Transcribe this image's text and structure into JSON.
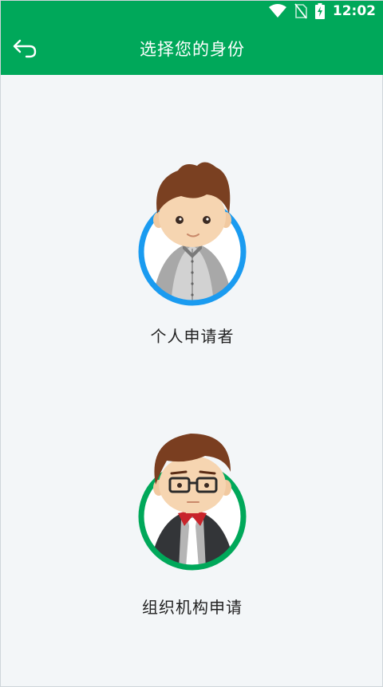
{
  "status_bar": {
    "time": "12:02",
    "icons": [
      "wifi-icon",
      "no-sim-icon",
      "battery-charging-icon"
    ]
  },
  "app_bar": {
    "title": "选择您的身份",
    "back_icon": "back-arrow-icon"
  },
  "roles": [
    {
      "label": "个人申请者",
      "ring_color": "#1a9bf0"
    },
    {
      "label": "组织机构申请",
      "ring_color": "#00a85a"
    }
  ],
  "colors": {
    "brand": "#00a85a",
    "background": "#f3f6f8"
  }
}
